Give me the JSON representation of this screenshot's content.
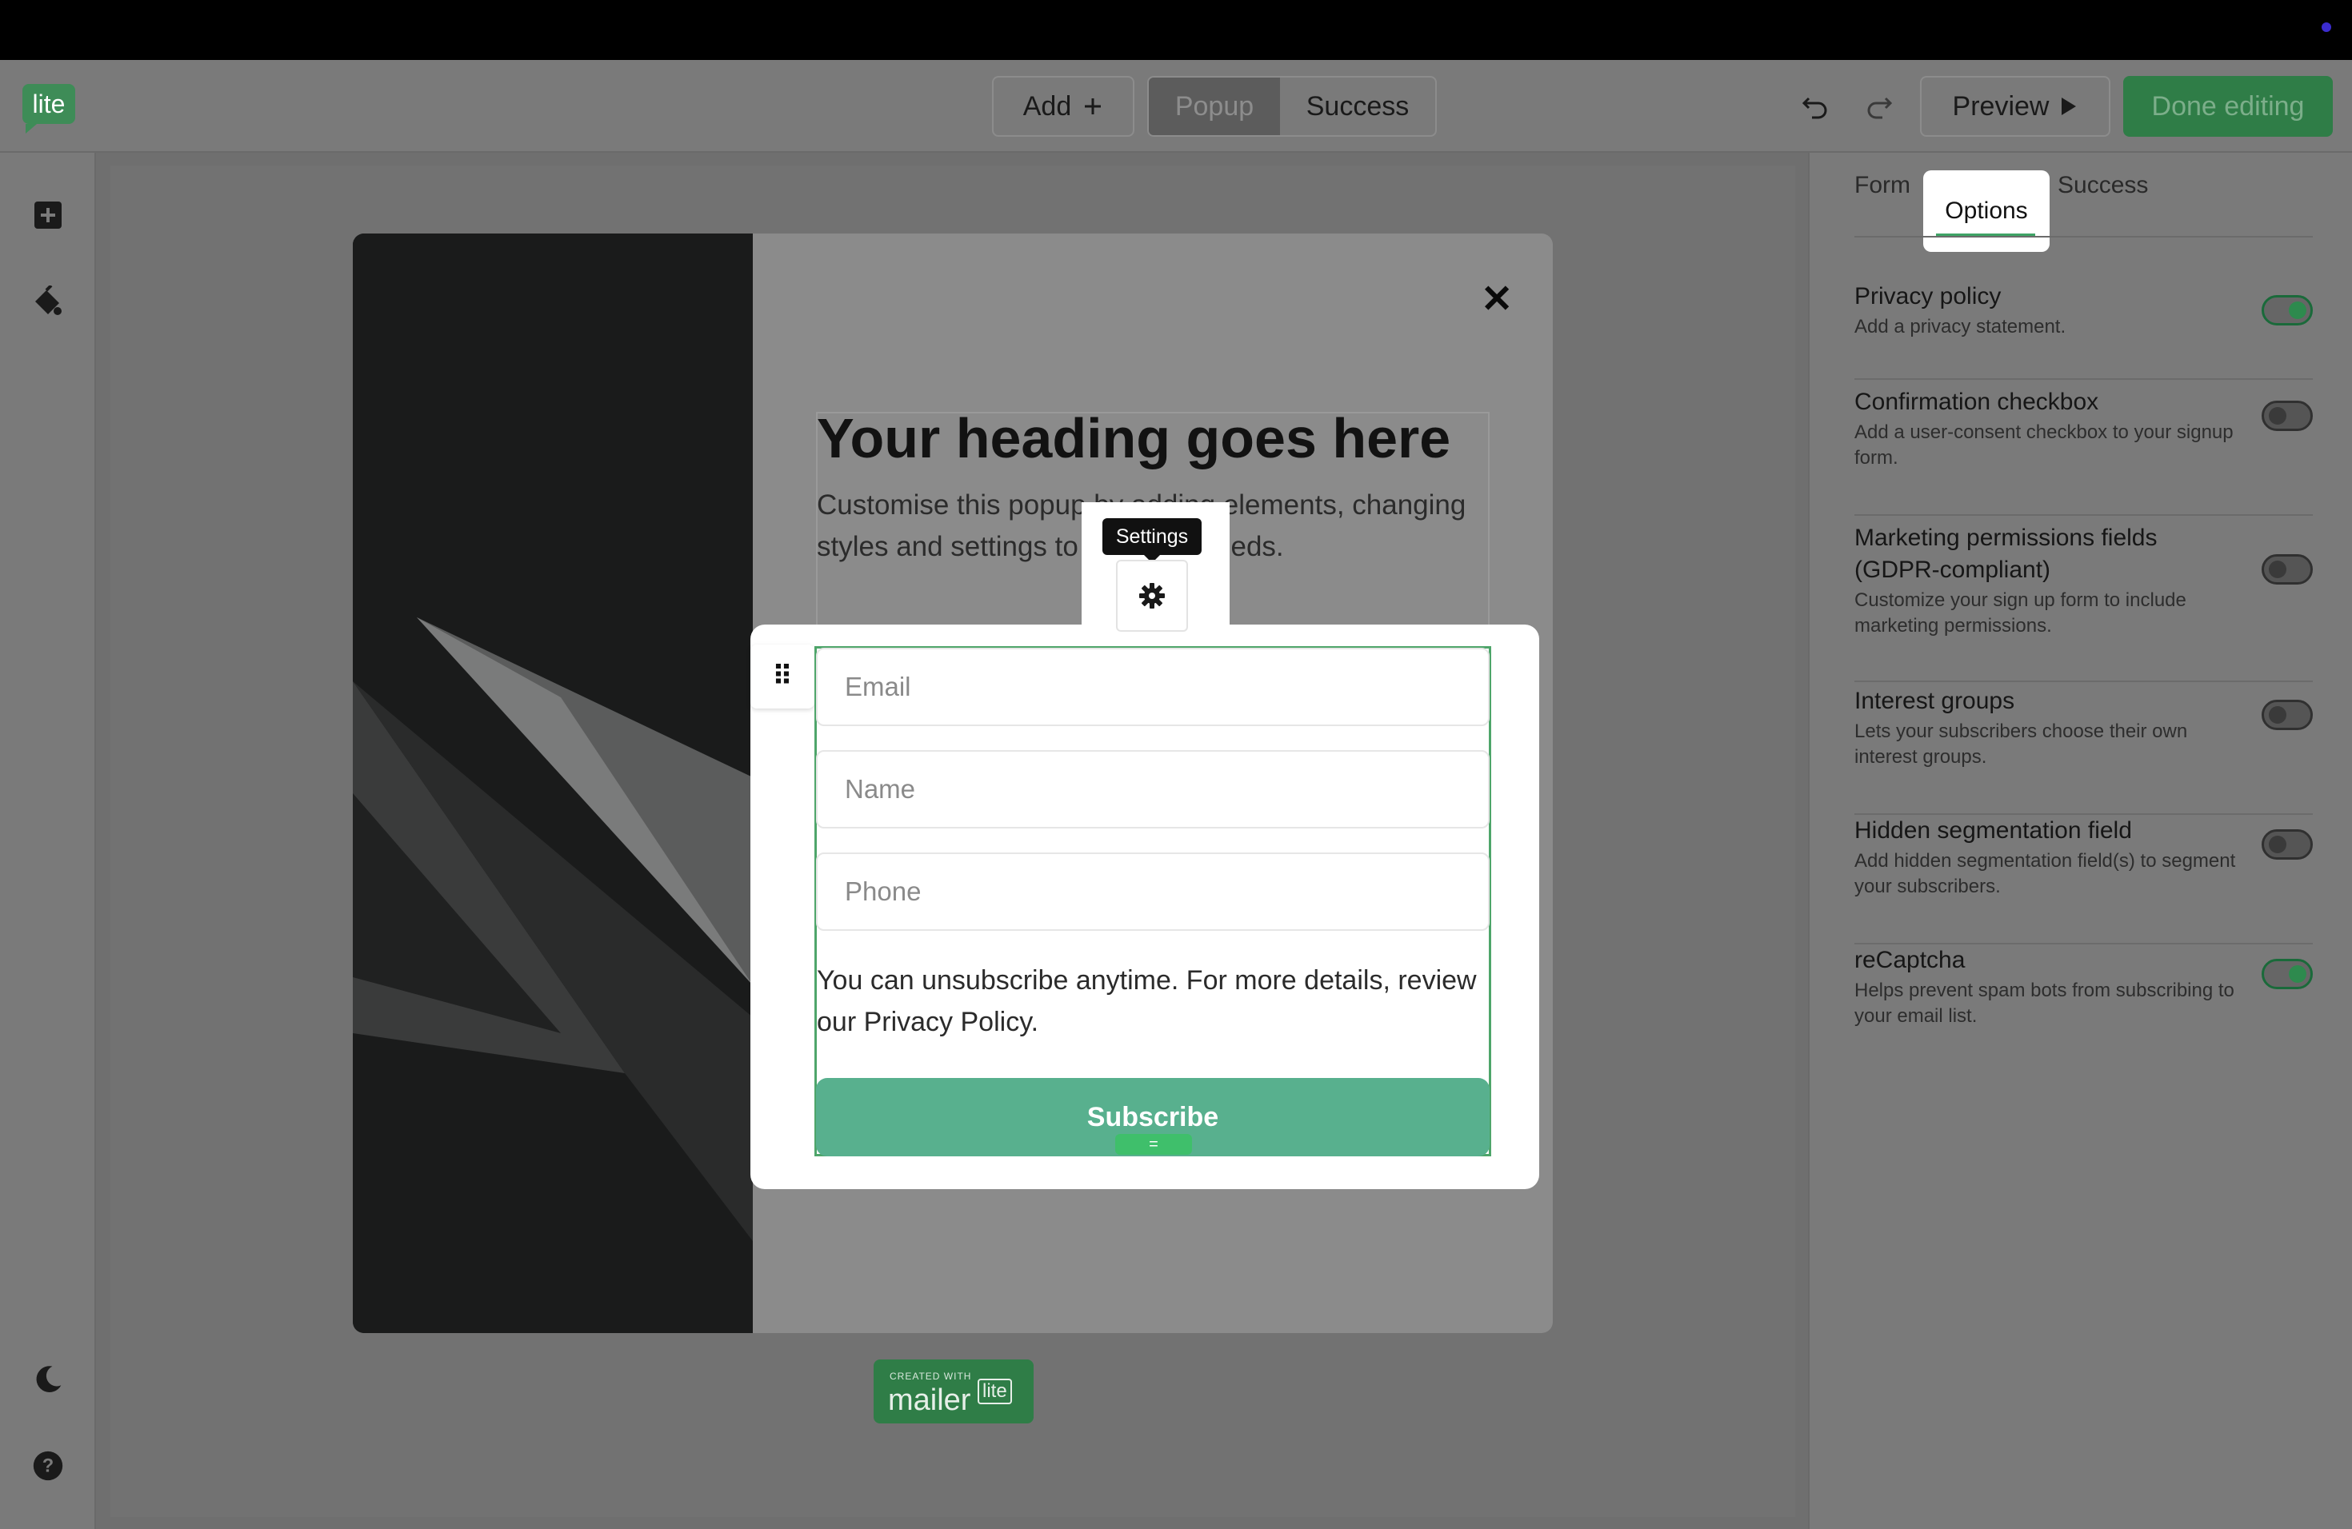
{
  "header": {
    "logo_text": "lite",
    "add_label": "Add",
    "tabs": [
      {
        "label": "Popup"
      },
      {
        "label": "Success"
      }
    ],
    "preview_label": "Preview",
    "done_label": "Done editing"
  },
  "popup": {
    "heading": "Your heading goes here",
    "subtext": "Customise this popup by adding elements, changing styles and settings to suit your needs.",
    "settings_tooltip": "Settings",
    "fields": {
      "email_placeholder": "Email",
      "name_placeholder": "Name",
      "phone_placeholder": "Phone"
    },
    "consent_text": "You can unsubscribe anytime. For more details, review our Privacy Policy.",
    "subscribe_label": "Subscribe",
    "badge": {
      "created_with": "CREATED WITH",
      "mailer": "mailer",
      "lite": "lite"
    }
  },
  "panel": {
    "tabs": {
      "form": "Form",
      "options": "Options",
      "success": "Success"
    },
    "options": [
      {
        "title": "Privacy policy",
        "desc": "Add a privacy statement.",
        "enabled": true
      },
      {
        "title": "Confirmation checkbox",
        "desc": "Add a user-consent checkbox to your signup form.",
        "enabled": false
      },
      {
        "title": "Marketing permissions fields (GDPR-compliant)",
        "desc": "Customize your sign up form to include marketing permissions.",
        "enabled": false
      },
      {
        "title": "Interest groups",
        "desc": "Lets your subscribers choose their own interest groups.",
        "enabled": false
      },
      {
        "title": "Hidden segmentation field",
        "desc": "Add hidden segmentation field(s) to segment your subscribers.",
        "enabled": false
      },
      {
        "title": "reCaptcha",
        "desc": "Helps prevent spam bots from subscribing to your email list.",
        "enabled": true
      }
    ]
  },
  "colors": {
    "brand_green": "#2f7d47",
    "subscribe_green": "#58b08e",
    "toggle_on": "#2e8a4e"
  }
}
